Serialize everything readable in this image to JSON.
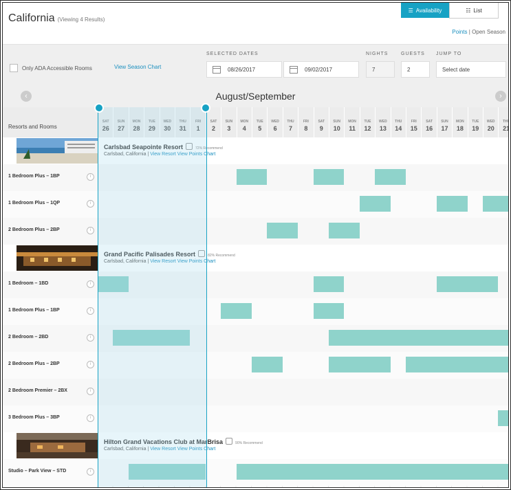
{
  "header": {
    "title": "California",
    "subtitle": "(Viewing 4 Results)",
    "view_availability": "Availability",
    "view_list": "List",
    "points_link": "Points",
    "separator": "|",
    "open_season": "Open Season"
  },
  "filters": {
    "ada_label": "Only ADA Accessible Rooms",
    "season_chart": "View Season Chart",
    "selected_dates_label": "SELECTED DATES",
    "start_date": "08/26/2017",
    "end_date": "09/02/2017",
    "nights_label": "NIGHTS",
    "nights": "7",
    "guests_label": "GUESTS",
    "guests": "2",
    "jump_label": "JUMP TO",
    "jump_placeholder": "Select date"
  },
  "calendar": {
    "month": "August/September",
    "column_header": "Resorts and Rooms",
    "days": [
      {
        "d": "SAT",
        "n": "26"
      },
      {
        "d": "SUN",
        "n": "27"
      },
      {
        "d": "MON",
        "n": "28"
      },
      {
        "d": "TUE",
        "n": "29"
      },
      {
        "d": "WED",
        "n": "30"
      },
      {
        "d": "THU",
        "n": "31"
      },
      {
        "d": "FRI",
        "n": "1"
      },
      {
        "d": "SAT",
        "n": "2"
      },
      {
        "d": "SUN",
        "n": "3"
      },
      {
        "d": "MON",
        "n": "4"
      },
      {
        "d": "TUE",
        "n": "5"
      },
      {
        "d": "WED",
        "n": "6"
      },
      {
        "d": "THU",
        "n": "7"
      },
      {
        "d": "FRI",
        "n": "8"
      },
      {
        "d": "SAT",
        "n": "9"
      },
      {
        "d": "SUN",
        "n": "10"
      },
      {
        "d": "MON",
        "n": "11"
      },
      {
        "d": "TUE",
        "n": "12"
      },
      {
        "d": "WED",
        "n": "13"
      },
      {
        "d": "THU",
        "n": "14"
      },
      {
        "d": "FRI",
        "n": "15"
      },
      {
        "d": "SAT",
        "n": "16"
      },
      {
        "d": "SUN",
        "n": "17"
      },
      {
        "d": "MON",
        "n": "18"
      },
      {
        "d": "TUE",
        "n": "19"
      },
      {
        "d": "WED",
        "n": "20"
      },
      {
        "d": "THU",
        "n": "21"
      }
    ]
  },
  "rows": [
    {
      "type": "resort",
      "name": "Carlsbad Seapointe Resort",
      "recommend": "72% Recommend",
      "location": "Carlsbad, California",
      "view_resort": "View Resort",
      "view_points": "View Points Chart",
      "sep": "|",
      "thumb": "thumb-beach"
    },
    {
      "type": "room",
      "label": "1 Bedroom Plus – 1BP",
      "avail": [
        [
          9,
          2
        ],
        [
          14,
          2
        ],
        [
          18,
          2
        ]
      ]
    },
    {
      "type": "room",
      "label": "1 Bedroom Plus – 1QP",
      "avail": [
        [
          17,
          2
        ],
        [
          22,
          2
        ],
        [
          25,
          2
        ]
      ]
    },
    {
      "type": "room",
      "label": "2 Bedroom Plus – 2BP",
      "avail": [
        [
          11,
          2
        ],
        [
          15,
          2
        ]
      ]
    },
    {
      "type": "resort",
      "name": "Grand Pacific Palisades Resort",
      "recommend": "82% Recommend",
      "location": "Carlsbad, California",
      "view_resort": "View Resort",
      "view_points": "View Points Chart",
      "sep": "|",
      "thumb": "thumb-palisades"
    },
    {
      "type": "room",
      "label": "1 Bedroom – 1BD",
      "avail": [
        [
          0,
          2
        ],
        [
          14,
          2
        ],
        [
          22,
          4
        ]
      ]
    },
    {
      "type": "room",
      "label": "1 Bedroom Plus – 1BP",
      "avail": [
        [
          8,
          2
        ],
        [
          14,
          2
        ]
      ]
    },
    {
      "type": "room",
      "label": "2 Bedroom – 2BD",
      "avail": [
        [
          1,
          5
        ],
        [
          15,
          12
        ]
      ]
    },
    {
      "type": "room",
      "label": "2 Bedroom Plus – 2BP",
      "avail": [
        [
          10,
          2
        ],
        [
          15,
          4
        ],
        [
          20,
          7
        ]
      ]
    },
    {
      "type": "room",
      "label": "2 Bedroom Premier – 2BX",
      "avail": []
    },
    {
      "type": "room",
      "label": "3 Bedroom Plus – 3BP",
      "avail": [
        [
          26,
          1
        ]
      ]
    },
    {
      "type": "resort",
      "name": "Hilton Grand Vacations Club at MarBrisa",
      "recommend": "90% Recommend",
      "location": "Carlsbad, California",
      "view_resort": "View Resort",
      "view_points": "View Points Chart",
      "sep": "|",
      "thumb": "thumb-marbrisa"
    },
    {
      "type": "room",
      "label": "Studio – Park View – STD",
      "avail": [
        [
          2,
          5
        ],
        [
          9,
          18
        ]
      ]
    }
  ]
}
